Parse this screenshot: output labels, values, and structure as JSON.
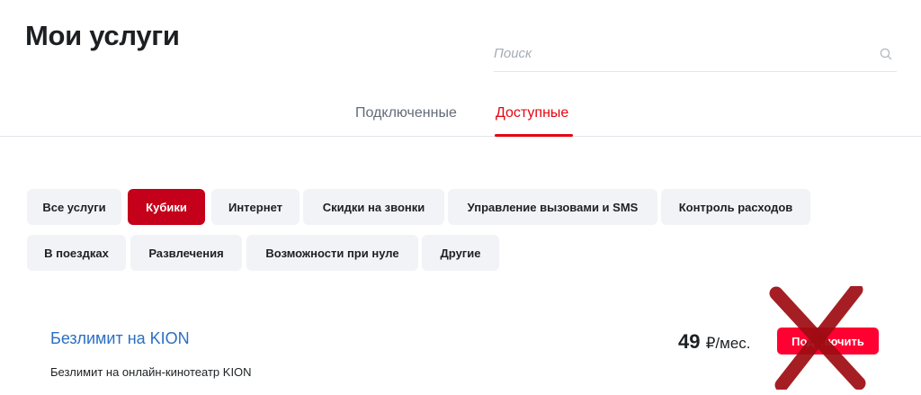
{
  "page": {
    "title": "Мои услуги"
  },
  "search": {
    "placeholder": "Поиск",
    "value": "",
    "icon": "search-icon"
  },
  "tabs": [
    {
      "label": "Подключенные",
      "active": false
    },
    {
      "label": "Доступные",
      "active": true
    }
  ],
  "categories": [
    {
      "label": "Все услуги",
      "active": false
    },
    {
      "label": "Кубики",
      "active": true
    },
    {
      "label": "Интернет",
      "active": false
    },
    {
      "label": "Скидки на звонки",
      "active": false
    },
    {
      "label": "Управление вызовами и SMS",
      "active": false
    },
    {
      "label": "Контроль расходов",
      "active": false
    },
    {
      "label": "В поездках",
      "active": false
    },
    {
      "label": "Развлечения",
      "active": false
    },
    {
      "label": "Возможности при нуле",
      "active": false
    },
    {
      "label": "Другие",
      "active": false
    }
  ],
  "service": {
    "title": "Безлимит на KION",
    "description": "Безлимит на онлайн-кинотеатр KION",
    "price": "49",
    "price_unit": "₽/мес.",
    "connect_label": "Подключить"
  },
  "colors": {
    "accent": "#e30611",
    "active_chip": "#c4001a",
    "button": "#ff0032",
    "link": "#2b6fc3",
    "cross_mark": "#9e0c12"
  }
}
